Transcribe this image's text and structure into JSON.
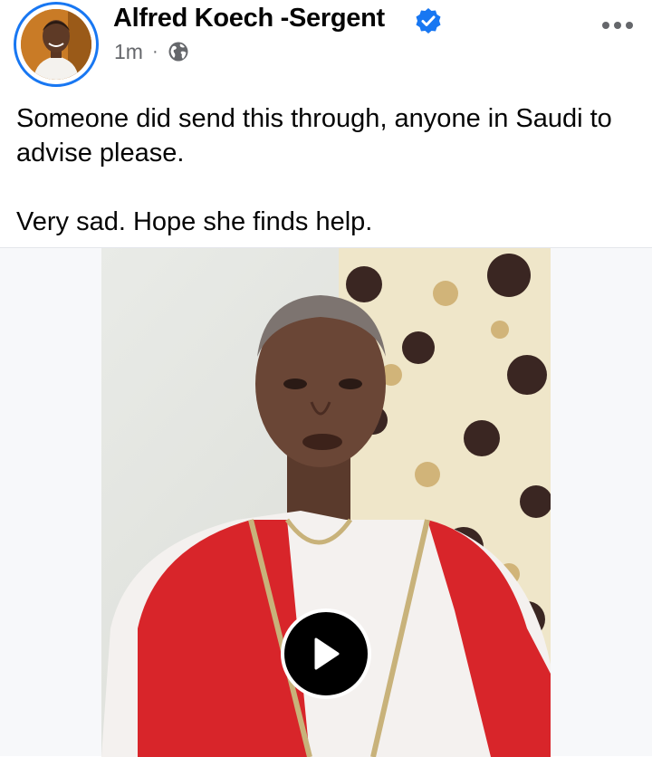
{
  "post": {
    "author_name": "Alfred Koech -Sergent",
    "timestamp": "1m",
    "separator": "·",
    "privacy_icon": "globe-icon",
    "verified_icon": "verified-badge-icon",
    "more_icon": "more-options-icon",
    "text_paragraphs": [
      "Someone did send this through, anyone in Saudi to advise please.",
      "Very sad. Hope she finds help."
    ]
  },
  "media": {
    "type": "video",
    "play_icon": "play-icon"
  },
  "colors": {
    "brand_blue": "#1877f2",
    "text_primary": "#050505",
    "text_secondary": "#65676b"
  }
}
